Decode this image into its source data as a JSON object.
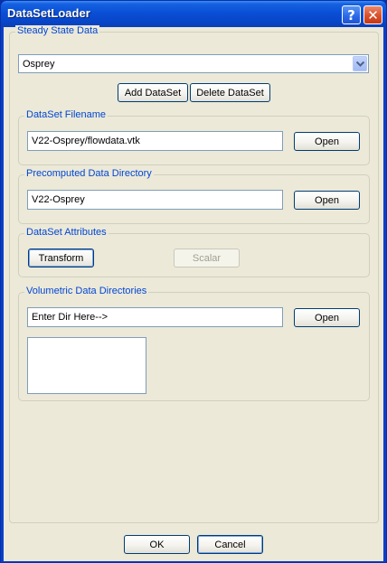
{
  "window": {
    "title": "DataSetLoader",
    "help_label": "?",
    "close_label": "✕"
  },
  "steady_state": {
    "legend": "Steady State Data",
    "selected": "Osprey",
    "add_label": "Add DataSet",
    "delete_label": "Delete DataSet"
  },
  "filename": {
    "legend": "DataSet Filename",
    "value": "V22-Osprey/flowdata.vtk",
    "open_label": "Open"
  },
  "precomputed": {
    "legend": "Precomputed Data Directory",
    "value": "V22-Osprey",
    "open_label": "Open"
  },
  "attributes": {
    "legend": "DataSet Attributes",
    "transform_label": "Transform",
    "scalar_label": "Scalar"
  },
  "volumetric": {
    "legend": "Volumetric Data Directories",
    "value": "Enter Dir Here-->",
    "open_label": "Open"
  },
  "footer": {
    "ok_label": "OK",
    "cancel_label": "Cancel"
  }
}
